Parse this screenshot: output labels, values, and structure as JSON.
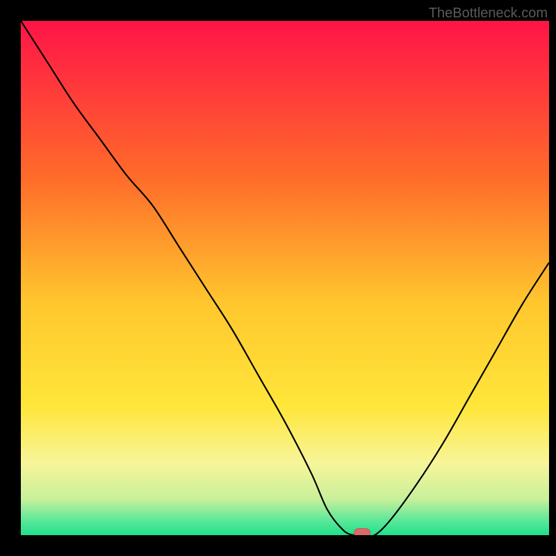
{
  "watermark": "TheBottleneck.com",
  "chart_data": {
    "type": "line",
    "title": "",
    "xlabel": "",
    "ylabel": "",
    "xlim": [
      0,
      100
    ],
    "ylim": [
      0,
      100
    ],
    "series": [
      {
        "name": "bottleneck_curve",
        "x": [
          0,
          5,
          10,
          15,
          20,
          25,
          30,
          35,
          40,
          45,
          50,
          55,
          58,
          61,
          63,
          65,
          67,
          70,
          75,
          80,
          85,
          90,
          95,
          100
        ],
        "y": [
          100,
          92,
          84,
          77,
          70,
          64,
          56,
          48,
          40,
          31,
          22,
          12,
          5,
          1,
          0,
          0,
          0,
          3,
          10,
          18,
          27,
          36,
          45,
          53
        ]
      }
    ],
    "marker": {
      "x": 64.5,
      "y": 0
    },
    "gradient_colors": {
      "top": "#ff1447",
      "upper_mid": "#ff8a2a",
      "mid": "#ffd92e",
      "lower_mid": "#f7f58a",
      "near_bottom": "#c8f09a",
      "bottom": "#1fe08a"
    }
  }
}
